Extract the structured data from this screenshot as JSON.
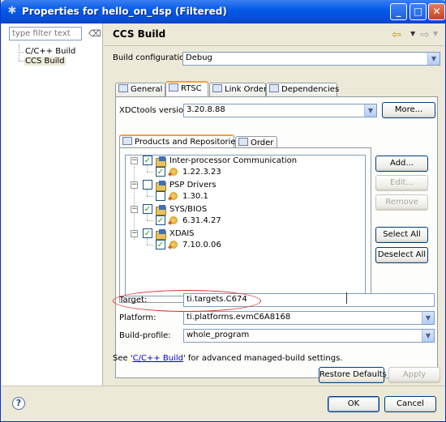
{
  "window": {
    "title": "Properties for hello_on_dsp (Filtered)",
    "icon": "properties-icon"
  },
  "sidebar": {
    "filter_placeholder": "type filter text",
    "items": [
      {
        "label": "C/C++ Build"
      },
      {
        "label": "CCS Build"
      }
    ]
  },
  "page": {
    "title": "CCS Build",
    "build_config_label": "Build configuration:",
    "build_config_value": "Debug",
    "tabs": [
      {
        "label": "General",
        "icon": "general-icon"
      },
      {
        "label": "RTSC",
        "icon": "rtsc-icon"
      },
      {
        "label": "Link Order",
        "icon": "link-order-icon"
      },
      {
        "label": "Dependencies",
        "icon": "dependencies-icon"
      }
    ],
    "active_tab": "RTSC",
    "xdctools_label": "XDCtools version:",
    "xdctools_value": "3.20.8.88",
    "more_button": "More...",
    "subtabs": [
      {
        "label": "Products and Repositories"
      },
      {
        "label": "Order"
      }
    ],
    "tree": [
      {
        "label": "Inter-processor Communication",
        "checked": true,
        "version": "1.22.3.23",
        "version_checked": true
      },
      {
        "label": "PSP Drivers",
        "checked": false,
        "version": "1.30.1",
        "version_checked": false
      },
      {
        "label": "SYS/BIOS",
        "checked": true,
        "version": "6.31.4.27",
        "version_checked": true
      },
      {
        "label": "XDAIS",
        "checked": true,
        "version": "7.10.0.06",
        "version_checked": true
      }
    ],
    "side_buttons": {
      "add": "Add...",
      "edit": "Edit...",
      "remove": "Remove",
      "select_all": "Select All",
      "deselect_all": "Deselect All"
    },
    "target_label": "Target:",
    "target_value": "ti.targets.C674",
    "platform_label": "Platform:",
    "platform_value": "ti.platforms.evmC6A8168",
    "build_profile_label": "Build-profile:",
    "build_profile_value": "whole_program",
    "footer_note_prefix": "See '",
    "footer_note_link": "C/C++ Build",
    "footer_note_suffix": "' for advanced managed-build settings.",
    "restore_defaults": "Restore Defaults",
    "apply": "Apply"
  },
  "dialog": {
    "ok": "OK",
    "cancel": "Cancel"
  },
  "colors": {
    "titlebar": "#0058e6",
    "accent_tab": "#f2a23c",
    "annotation_ellipse": "#e03131"
  }
}
